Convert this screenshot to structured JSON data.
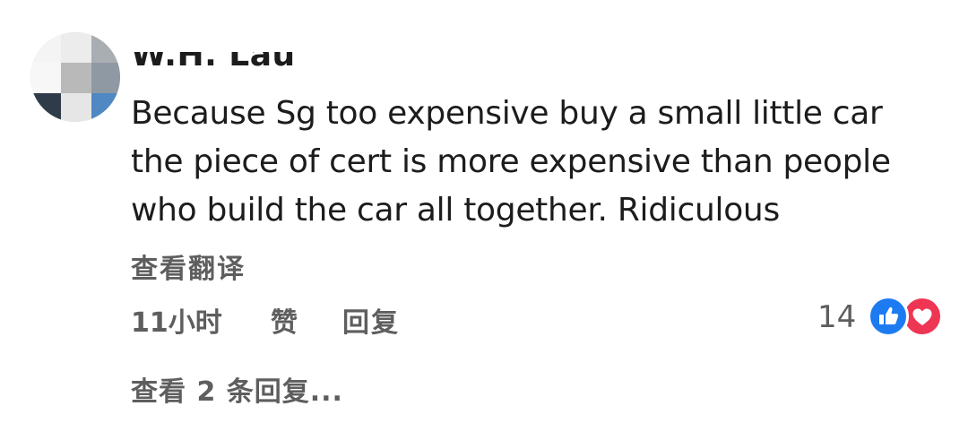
{
  "comment": {
    "author": "W.H. Lau",
    "text_lines": [
      "Because Sg too expensive buy a small little car",
      "the piece of cert is more expensive than people",
      "who build the car all together. Ridiculous"
    ],
    "translate_label": "查看翻译",
    "time": "11小时",
    "like_label": "赞",
    "reply_label": "回复",
    "reaction_count": "14",
    "view_replies_label": "查看 2 条回复..."
  },
  "icons": {
    "like_reaction": "thumbs-up-icon",
    "love_reaction": "heart-icon"
  },
  "colors": {
    "like_blue": "#1d7bf2",
    "love_red": "#ee3654",
    "secondary_text": "#5e5e5e"
  }
}
